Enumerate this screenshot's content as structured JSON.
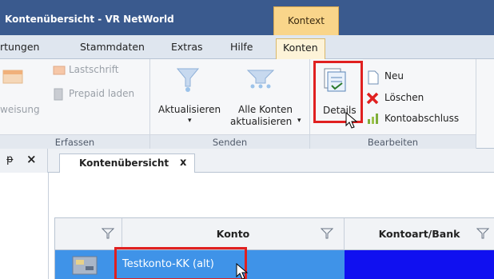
{
  "window": {
    "title": "Kontenübersicht - VR NetWorld",
    "context_tab": "Kontext"
  },
  "menu": {
    "items": [
      "rtungen",
      "Stammdaten",
      "Extras",
      "Hilfe",
      "Konten"
    ],
    "active": "Konten"
  },
  "ribbon": {
    "erfassen": {
      "label": "Erfassen",
      "lastschrift": "Lastschrift",
      "prepaid": "Prepaid laden",
      "weisung": "weisung"
    },
    "senden": {
      "label": "Senden",
      "aktualisieren": "Aktualisieren",
      "alle_konten_1": "Alle Konten",
      "alle_konten_2": "aktualisieren"
    },
    "bearbeiten": {
      "label": "Bearbeiten",
      "details": "Details",
      "neu": "Neu",
      "loeschen": "Löschen",
      "kontoabschluss": "Kontoabschluss"
    }
  },
  "pane": {
    "pin": "ᵽ",
    "close": "×"
  },
  "document_tab": {
    "label": "Kontenübersicht",
    "close": "x"
  },
  "grid": {
    "columns": [
      "",
      "Konto",
      "Kontoart/Bank"
    ],
    "rows": [
      {
        "konto": "Testkonto-KK (alt)"
      }
    ]
  },
  "colors": {
    "titlebar": "#3a5a8e",
    "context_tab": "#f9d58a",
    "highlight": "#e02020",
    "selected_row": "#3f93e8",
    "blue_cell": "#1010f0"
  }
}
